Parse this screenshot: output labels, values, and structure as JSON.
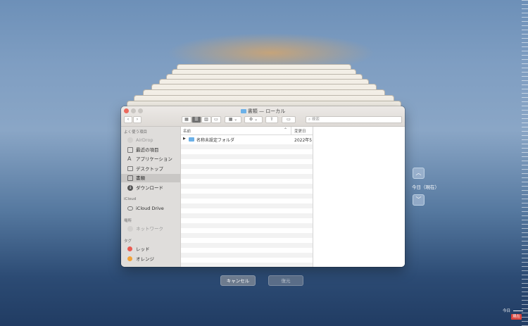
{
  "window": {
    "title": "書類 — ローカル"
  },
  "toolbar": {
    "search_placeholder": "検索"
  },
  "sidebar": {
    "favorites_header": "よく使う項目",
    "favorites": [
      {
        "label": "AirDrop",
        "icon": "airdrop-icon",
        "dimmed": true
      },
      {
        "label": "最近の項目",
        "icon": "recents-icon"
      },
      {
        "label": "アプリケーション",
        "icon": "applications-icon"
      },
      {
        "label": "デスクトップ",
        "icon": "desktop-icon"
      },
      {
        "label": "書類",
        "icon": "documents-icon",
        "selected": true
      },
      {
        "label": "ダウンロード",
        "icon": "downloads-icon"
      }
    ],
    "icloud_header": "iCloud",
    "icloud_items": [
      {
        "label": "iCloud Drive",
        "icon": "cloud-icon"
      }
    ],
    "locations_header": "場所",
    "locations": [
      {
        "label": "ネットワーク",
        "icon": "network-icon",
        "dimmed": true
      }
    ],
    "tags_header": "タグ",
    "tags": [
      {
        "label": "レッド",
        "color": "#ea5b52"
      },
      {
        "label": "オレンジ",
        "color": "#f2a33a"
      }
    ]
  },
  "file_list": {
    "columns": {
      "name": "名前",
      "date": "変更日"
    },
    "rows": [
      {
        "name": "名称未設定フォルダ",
        "date": "2022年5"
      }
    ]
  },
  "buttons": {
    "cancel": "キャンセル",
    "restore": "復元"
  },
  "timemachine": {
    "current_label": "今日（現在）",
    "today_tick": "今日",
    "now_tick": "現在"
  },
  "colors": {
    "folder": "#6cb1e8",
    "now_marker": "#d9433b"
  }
}
